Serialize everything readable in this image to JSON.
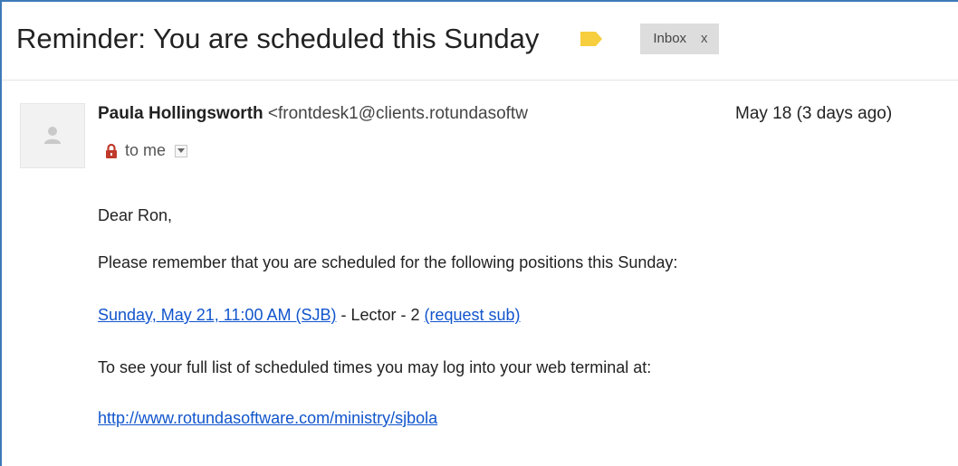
{
  "subject": "Reminder: You are scheduled this Sunday",
  "label_chip": {
    "text": "Inbox",
    "close": "x"
  },
  "colors": {
    "frame": "#3d7ab8",
    "link": "#1155cc",
    "label_tag": "#f6ce3e",
    "lock": "#c0392b"
  },
  "sender": {
    "name": "Paula Hollingsworth",
    "email": "<frontdesk1@clients.rotundasoftw",
    "date": "May 18 (3 days ago)"
  },
  "recipient": {
    "text": "to me"
  },
  "body": {
    "greeting": "Dear Ron,",
    "line1": "Please remember that you are scheduled for the following positions this Sunday:",
    "schedule_link": "Sunday, May 21, 11:00 AM (SJB)",
    "schedule_detail": " - Lector - 2 ",
    "request_sub": "(request sub)",
    "line2": "To see your full list of scheduled times you may log into your web terminal at:",
    "terminal_link": "http://www.rotundasoftware.com/ministry/sjbola"
  },
  "icons": {
    "label": "label-tag-icon",
    "avatar": "person-silhouette-icon",
    "lock": "padlock-icon",
    "dropdown": "chevron-down-icon"
  }
}
